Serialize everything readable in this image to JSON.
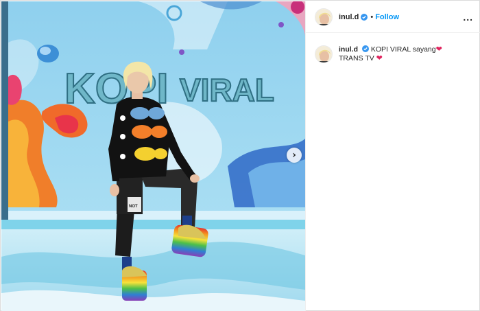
{
  "post": {
    "username": "inul.d",
    "separator": "•",
    "follow_label": "Follow",
    "more_label": "...",
    "caption_username": "inul.d",
    "caption_line1": "KOPI VIRAL sayang",
    "caption_line2": "TRANS TV",
    "heart": "❤"
  },
  "photo": {
    "backdrop_title_1": "KOPI",
    "backdrop_title_2": "VIRAL",
    "shirt_badge": "NOT"
  },
  "colors": {
    "follow_blue": "#0095f6",
    "verified_blue": "#3897f0",
    "heart_red": "#e0245e",
    "stage_cyan": "#7fd3ea"
  },
  "icons": {
    "verified": "verified-badge-icon",
    "next": "chevron-right-icon",
    "more": "more-options-icon"
  }
}
